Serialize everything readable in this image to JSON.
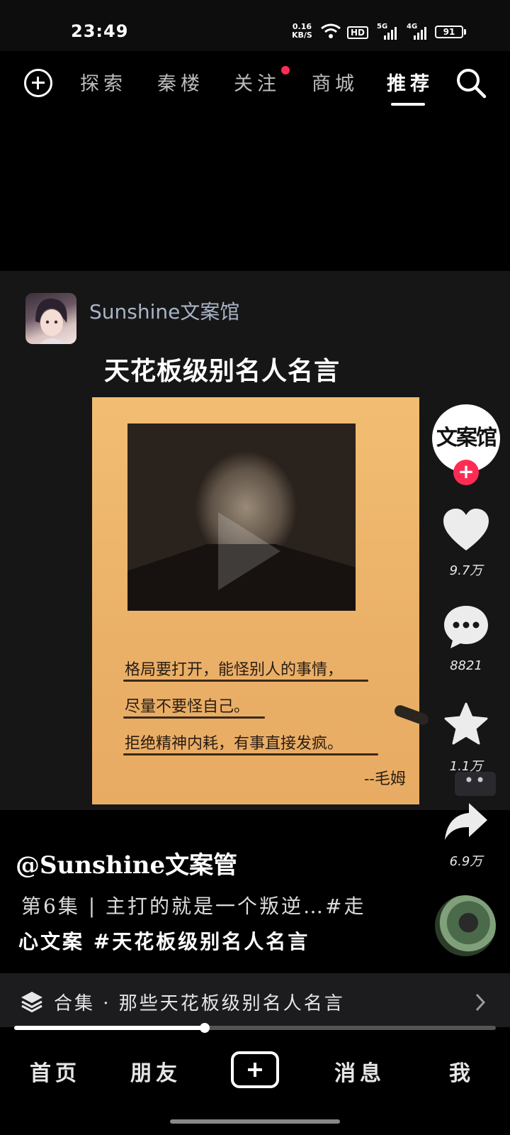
{
  "status_bar": {
    "time": "23:49",
    "net_speed_value": "0.16",
    "net_speed_unit": "KB/S",
    "hd": "HD",
    "net1": "5G",
    "net2": "4G",
    "battery": "91"
  },
  "top_nav": {
    "tabs": [
      {
        "label": "探索"
      },
      {
        "label": "秦楼"
      },
      {
        "label": "关注"
      },
      {
        "label": "商城"
      },
      {
        "label": "推荐"
      }
    ],
    "active_tab": "推荐",
    "accent": "#fe2c55"
  },
  "video": {
    "author": "Sunshine文案馆",
    "title": "天花板级别名人名言",
    "quote_lines": [
      "格局要打开，能怪别人的事情，",
      "尽量不要怪自己。",
      "拒绝精神内耗，有事直接发疯。"
    ],
    "quote_author": "--毛姆"
  },
  "rail": {
    "creator_logo": "文案馆",
    "follow": "+",
    "likes": "9.7万",
    "comments": "8821",
    "favorites": "1.1万",
    "more": "••",
    "shares": "6.9万"
  },
  "caption": {
    "user": "@Sunshine文案管",
    "line1": "第6集 | 主打的就是一个叛逆…#走",
    "line2": "心文案 #天花板级别名人名言"
  },
  "collection": {
    "label": "合集 · 那些天花板级别名人名言"
  },
  "progress": {
    "fraction": 0.395
  },
  "bottom_nav": {
    "home": "首页",
    "friends": "朋友",
    "messages": "消息",
    "me": "我"
  }
}
